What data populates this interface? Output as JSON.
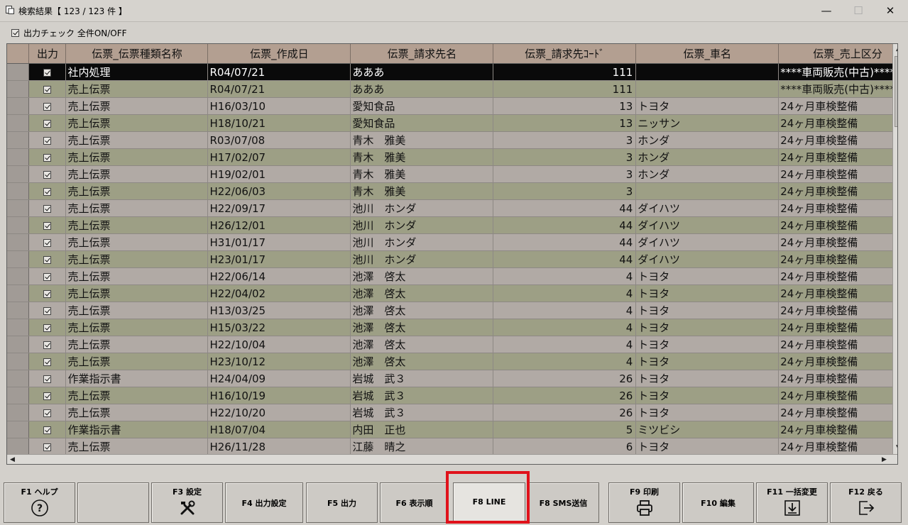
{
  "window": {
    "title": "検索結果【 123 / 123 件 】",
    "minimize": "—",
    "maximize": "☐",
    "close": "✕"
  },
  "output_check": {
    "label": "出力チェック 全件ON/OFF",
    "checked": true
  },
  "grid": {
    "columns": [
      "出力",
      "伝票_伝票種類名称",
      "伝票_作成日",
      "伝票_請求先名",
      "伝票_請求先ｺｰﾄﾞ",
      "伝票_車名",
      "伝票_売上区分"
    ],
    "rows": [
      {
        "out": true,
        "type": "社内処理",
        "date": "R04/07/21",
        "client": "あああ",
        "code": "111",
        "car": "",
        "sales": "****車両販売(中古)****"
      },
      {
        "out": true,
        "type": "売上伝票",
        "date": "R04/07/21",
        "client": "あああ",
        "code": "111",
        "car": "",
        "sales": "****車両販売(中古)****"
      },
      {
        "out": true,
        "type": "売上伝票",
        "date": "H16/03/10",
        "client": "愛知食品",
        "code": "13",
        "car": "トヨタ",
        "sales": "24ヶ月車検整備"
      },
      {
        "out": true,
        "type": "売上伝票",
        "date": "H18/10/21",
        "client": "愛知食品",
        "code": "13",
        "car": "ニッサン",
        "sales": "24ヶ月車検整備"
      },
      {
        "out": true,
        "type": "売上伝票",
        "date": "R03/07/08",
        "client": "青木　雅美",
        "code": "3",
        "car": "ホンダ",
        "sales": "24ヶ月車検整備"
      },
      {
        "out": true,
        "type": "売上伝票",
        "date": "H17/02/07",
        "client": "青木　雅美",
        "code": "3",
        "car": "ホンダ",
        "sales": "24ヶ月車検整備"
      },
      {
        "out": true,
        "type": "売上伝票",
        "date": "H19/02/01",
        "client": "青木　雅美",
        "code": "3",
        "car": "ホンダ",
        "sales": "24ヶ月車検整備"
      },
      {
        "out": true,
        "type": "売上伝票",
        "date": "H22/06/03",
        "client": "青木　雅美",
        "code": "3",
        "car": "",
        "sales": "24ヶ月車検整備"
      },
      {
        "out": true,
        "type": "売上伝票",
        "date": "H22/09/17",
        "client": "池川　ホンダ",
        "code": "44",
        "car": "ダイハツ",
        "sales": "24ヶ月車検整備"
      },
      {
        "out": true,
        "type": "売上伝票",
        "date": "H26/12/01",
        "client": "池川　ホンダ",
        "code": "44",
        "car": "ダイハツ",
        "sales": "24ヶ月車検整備"
      },
      {
        "out": true,
        "type": "売上伝票",
        "date": "H31/01/17",
        "client": "池川　ホンダ",
        "code": "44",
        "car": "ダイハツ",
        "sales": "24ヶ月車検整備"
      },
      {
        "out": true,
        "type": "売上伝票",
        "date": "H23/01/17",
        "client": "池川　ホンダ",
        "code": "44",
        "car": "ダイハツ",
        "sales": "24ヶ月車検整備"
      },
      {
        "out": true,
        "type": "売上伝票",
        "date": "H22/06/14",
        "client": "池澤　啓太",
        "code": "4",
        "car": "トヨタ",
        "sales": "24ヶ月車検整備"
      },
      {
        "out": true,
        "type": "売上伝票",
        "date": "H22/04/02",
        "client": "池澤　啓太",
        "code": "4",
        "car": "トヨタ",
        "sales": "24ヶ月車検整備"
      },
      {
        "out": true,
        "type": "売上伝票",
        "date": "H13/03/25",
        "client": "池澤　啓太",
        "code": "4",
        "car": "トヨタ",
        "sales": "24ヶ月車検整備"
      },
      {
        "out": true,
        "type": "売上伝票",
        "date": "H15/03/22",
        "client": "池澤　啓太",
        "code": "4",
        "car": "トヨタ",
        "sales": "24ヶ月車検整備"
      },
      {
        "out": true,
        "type": "売上伝票",
        "date": "H22/10/04",
        "client": "池澤　啓太",
        "code": "4",
        "car": "トヨタ",
        "sales": "24ヶ月車検整備"
      },
      {
        "out": true,
        "type": "売上伝票",
        "date": "H23/10/12",
        "client": "池澤　啓太",
        "code": "4",
        "car": "トヨタ",
        "sales": "24ヶ月車検整備"
      },
      {
        "out": true,
        "type": "作業指示書",
        "date": "H24/04/09",
        "client": "岩城　武３",
        "code": "26",
        "car": "トヨタ",
        "sales": "24ヶ月車検整備"
      },
      {
        "out": true,
        "type": "売上伝票",
        "date": "H16/10/19",
        "client": "岩城　武３",
        "code": "26",
        "car": "トヨタ",
        "sales": "24ヶ月車検整備"
      },
      {
        "out": true,
        "type": "売上伝票",
        "date": "H22/10/20",
        "client": "岩城　武３",
        "code": "26",
        "car": "トヨタ",
        "sales": "24ヶ月車検整備"
      },
      {
        "out": true,
        "type": "作業指示書",
        "date": "H18/07/04",
        "client": "内田　正也",
        "code": "5",
        "car": "ミツビシ",
        "sales": "24ヶ月車検整備"
      },
      {
        "out": true,
        "type": "売上伝票",
        "date": "H26/11/28",
        "client": "江藤　晴之",
        "code": "6",
        "car": "トヨタ",
        "sales": "24ヶ月車検整備"
      }
    ]
  },
  "fkeys": {
    "f1": "F1 ヘルプ",
    "f3": "F3 設定",
    "f4": "F4 出力設定",
    "f5": "F5 出力",
    "f6": "F6 表示順",
    "f8_line": "F8 LINE",
    "f8_sms": "F8 SMS送信",
    "f9": "F9 印刷",
    "f10": "F10 編集",
    "f11": "F11 一括変更",
    "f12": "F12 戻る"
  },
  "colors": {
    "highlight": "#e0121b",
    "row_selected": "#0a0a0a",
    "row_alt": "#9d9f85",
    "header": "#b39f91"
  },
  "icons": [
    "app-icon",
    "help-icon",
    "tools-icon",
    "printer-icon",
    "download-icon",
    "exit-icon"
  ]
}
